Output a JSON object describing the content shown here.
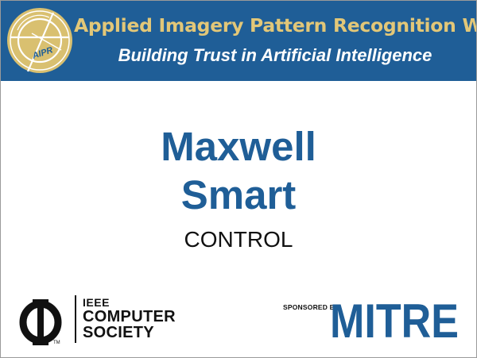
{
  "header": {
    "title": "Applied Imagery Pattern Recognition Workshop",
    "subtitle": "Building Trust in Artificial Intelligence",
    "logo_text": "AIPR",
    "background_color": "#1f5e97",
    "title_color": "#e2c778",
    "logo_icon": "aipr-seal-icon"
  },
  "attendee": {
    "first_name": "Maxwell",
    "last_name": "Smart",
    "affiliation": "CONTROL",
    "name_color": "#1f5e97"
  },
  "footer": {
    "computer_society": {
      "line1": "IEEE",
      "line2": "COMPUTER",
      "line3": "SOCIETY",
      "trademark": "TM",
      "icon": "ieee-computer-society-logo"
    },
    "sponsor": {
      "label": "SPONSORED BY",
      "name": "MITRE",
      "color": "#1f5e97"
    }
  }
}
